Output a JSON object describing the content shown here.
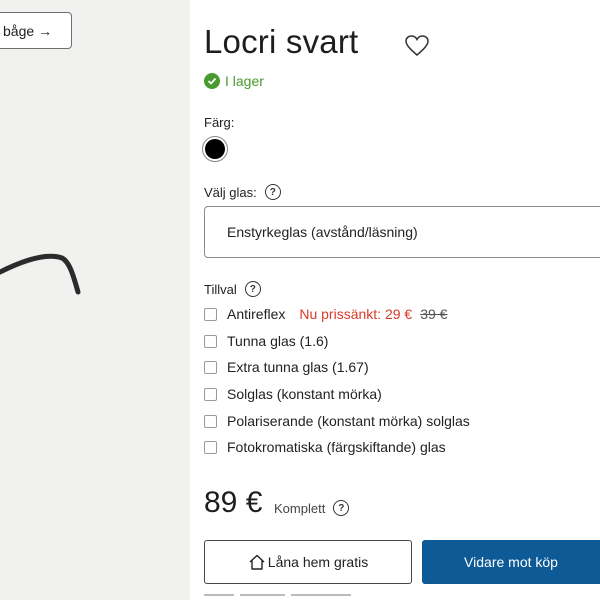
{
  "left": {
    "try_button_label": "båge",
    "try_button_arrow": "→"
  },
  "product": {
    "title": "Locri svart",
    "stock": "I lager"
  },
  "color": {
    "label": "Färg:",
    "selected": "#000000"
  },
  "lens": {
    "label": "Välj glas:",
    "selected": "Enstyrkeglas (avstånd/läsning)"
  },
  "options": {
    "label": "Tillval",
    "items": [
      {
        "label": "Antireflex",
        "sale": "Nu prissänkt: 29 €",
        "old_price": "39 €"
      },
      {
        "label": "Tunna glas (1.6)"
      },
      {
        "label": "Extra tunna glas (1.67)"
      },
      {
        "label": "Solglas (konstant mörka)"
      },
      {
        "label": "Polariserande (konstant mörka) solglas"
      },
      {
        "label": "Fotokromatiska (färgskiftande) glas"
      }
    ]
  },
  "price": {
    "amount": "89 €",
    "note": "Komplett"
  },
  "actions": {
    "loan_label": "Låna hem gratis",
    "buy_label": "Vidare mot köp"
  },
  "colors": {
    "accent": "#0d5a96",
    "in_stock": "#4a9a2f",
    "sale": "#d93a2a"
  }
}
